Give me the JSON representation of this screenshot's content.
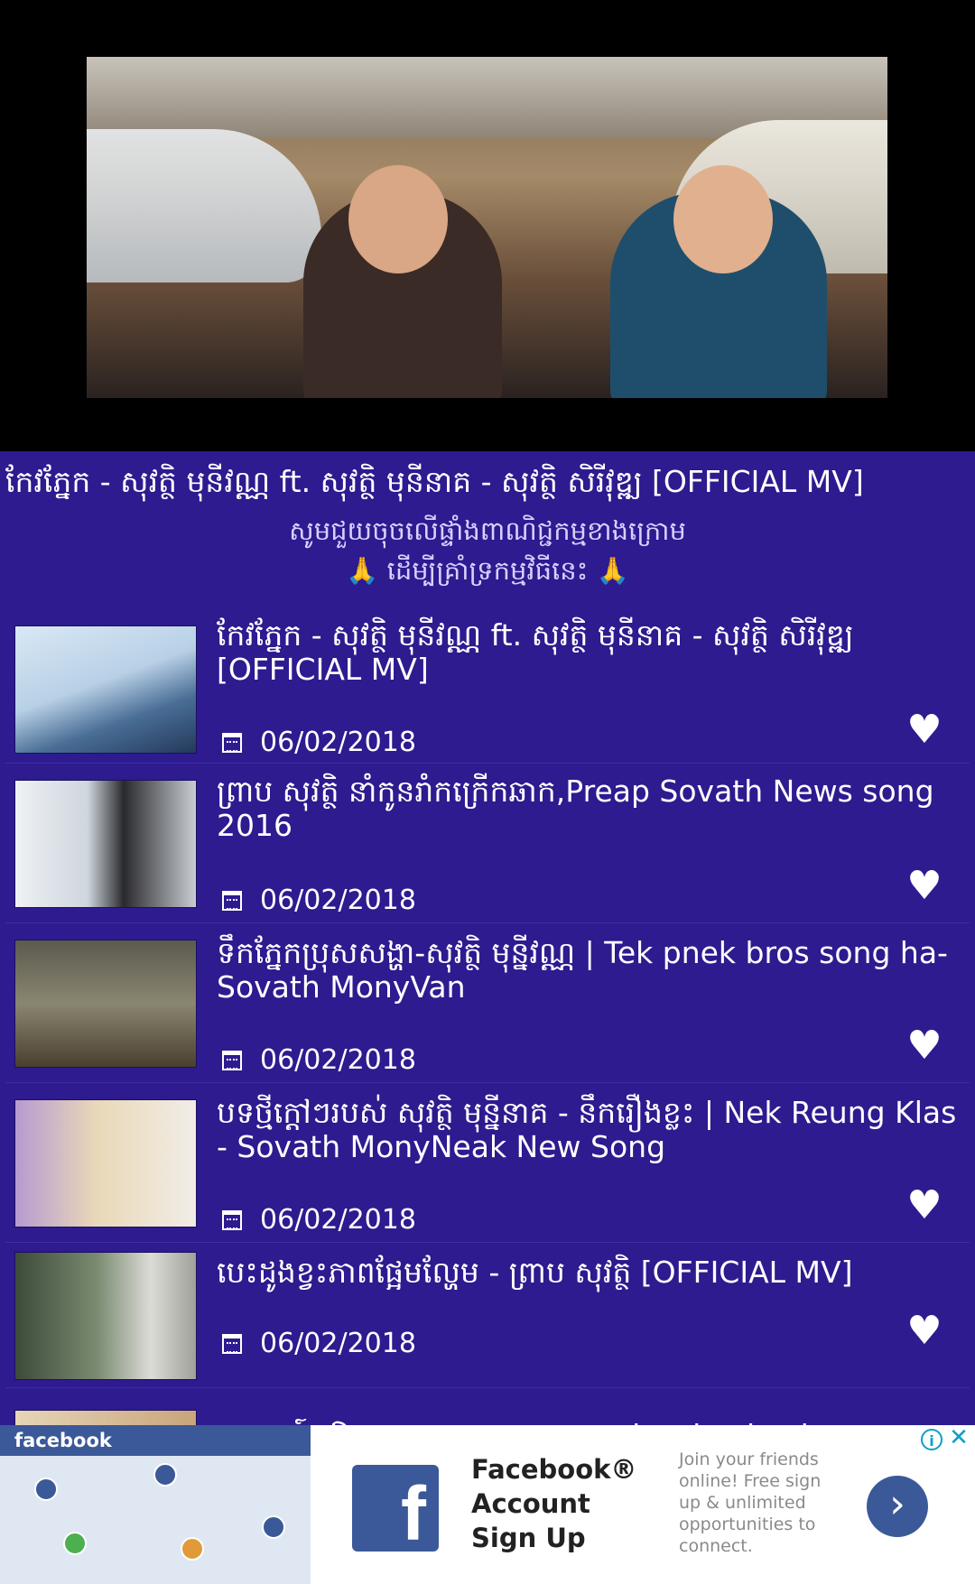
{
  "now_playing": {
    "title": "កែវភ្នែក - សុវត្ថិ មុនីវណ្ណ ft. សុវត្ថិ មុនីនាគ - សុវត្ថិ សិរីវុឌ្ឍ [OFFICIAL MV]",
    "support_line1": "សូមជួយចុចលើផ្ទាំងពាណិជ្ជកម្មខាងក្រោម",
    "support_line2": "ដើម្បីគ្រាំទ្រកម្មវិធីនេះ",
    "hand_icon": "🙏"
  },
  "videos": [
    {
      "title": "កែវភ្នែក - សុវត្ថិ មុនីវណ្ណ ft. សុវត្ថិ មុនីនាគ - សុវត្ថិ សិរីវុឌ្ឍ [OFFICIAL MV]",
      "date": "06/02/2018"
    },
    {
      "title": "ព្រាប សុវត្ថិ នាំកូនរាំកក្រើកឆាក,Preap Sovath News song 2016",
      "date": "06/02/2018"
    },
    {
      "title": "ទឹកភ្នែកប្រុសសង្ហា-សុវត្ថិ មុន្នីវណ្ណ | Tek pnek bros song ha-Sovath MonyVan",
      "date": "06/02/2018"
    },
    {
      "title": "បទថ្មីក្ដៅៗរបស់ សុវត្ថិ មុន្នីនាគ - នឹករឿងខ្លះ | Nek Reung Klas - Sovath MonyNeak New Song",
      "date": "06/02/2018"
    },
    {
      "title": "បេះដូងខ្វះភាពផ្អែមល្ហែម - ព្រាប សុវត្ថិ [OFFICIAL MV]",
      "date": "06/02/2018"
    },
    {
      "title": "អារម្មណ៍ -ឱក សុគន្ធកញ្ញា arom aok sokunkanha new song",
      "date": ""
    }
  ],
  "ad": {
    "brand_bar": "facebook",
    "logo_letter": "f",
    "headline": "Facebook® Account Sign Up",
    "body": "Join your friends online! Free sign up & unlimited opportunities to connect.",
    "cta_icon": "›",
    "info_icon": "i",
    "close_icon": "✕"
  },
  "colors": {
    "background": "#2d1b8f",
    "facebook_blue": "#3b5998"
  }
}
